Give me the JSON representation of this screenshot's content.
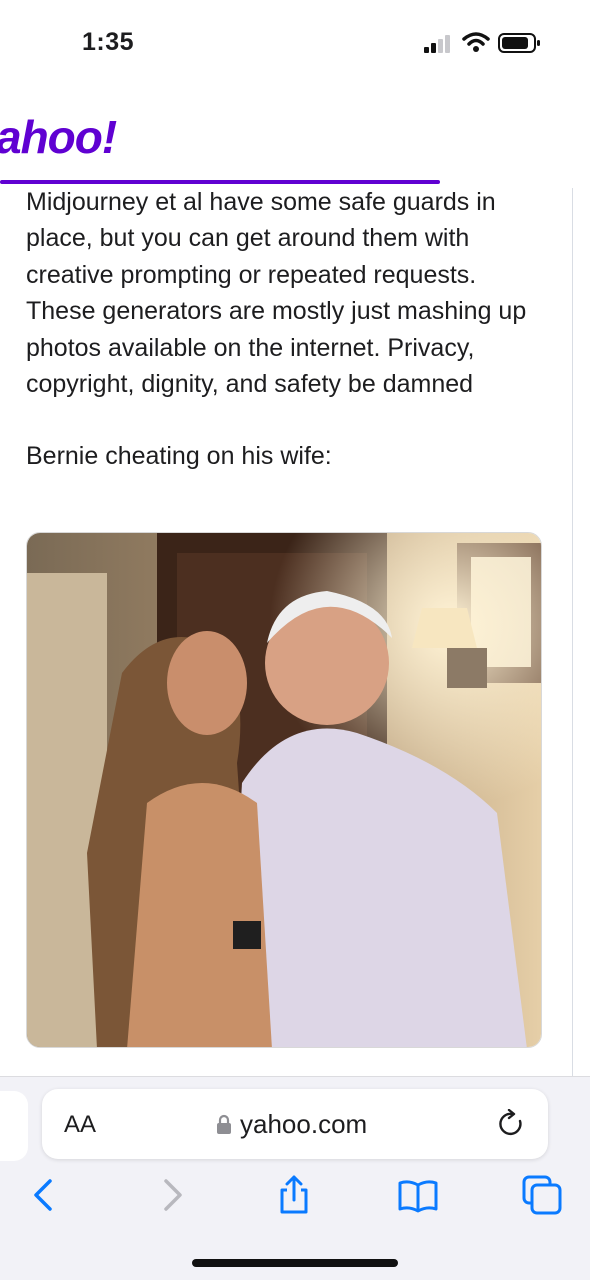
{
  "status": {
    "time": "1:35"
  },
  "header": {
    "logo_text": "ahoo!",
    "brand_color": "#6001d2"
  },
  "article": {
    "paragraph_1": "Midjourney et al have some safe guards in place, but you can get around them with creative prompting or repeated requests. These generators are mostly just mashing up photos available on the internet. Privacy, copyright, dignity, and safety be damned",
    "paragraph_2": "Bernie cheating on his wife:"
  },
  "toolbar": {
    "text_size_label": "AA",
    "url": "yahoo.com",
    "accent_color": "#0a7aff"
  },
  "icons": [
    "signal-icon",
    "wifi-icon",
    "battery-icon",
    "lock-icon",
    "reload-icon",
    "back-icon",
    "forward-icon",
    "share-icon",
    "bookmarks-icon",
    "tabs-icon"
  ]
}
